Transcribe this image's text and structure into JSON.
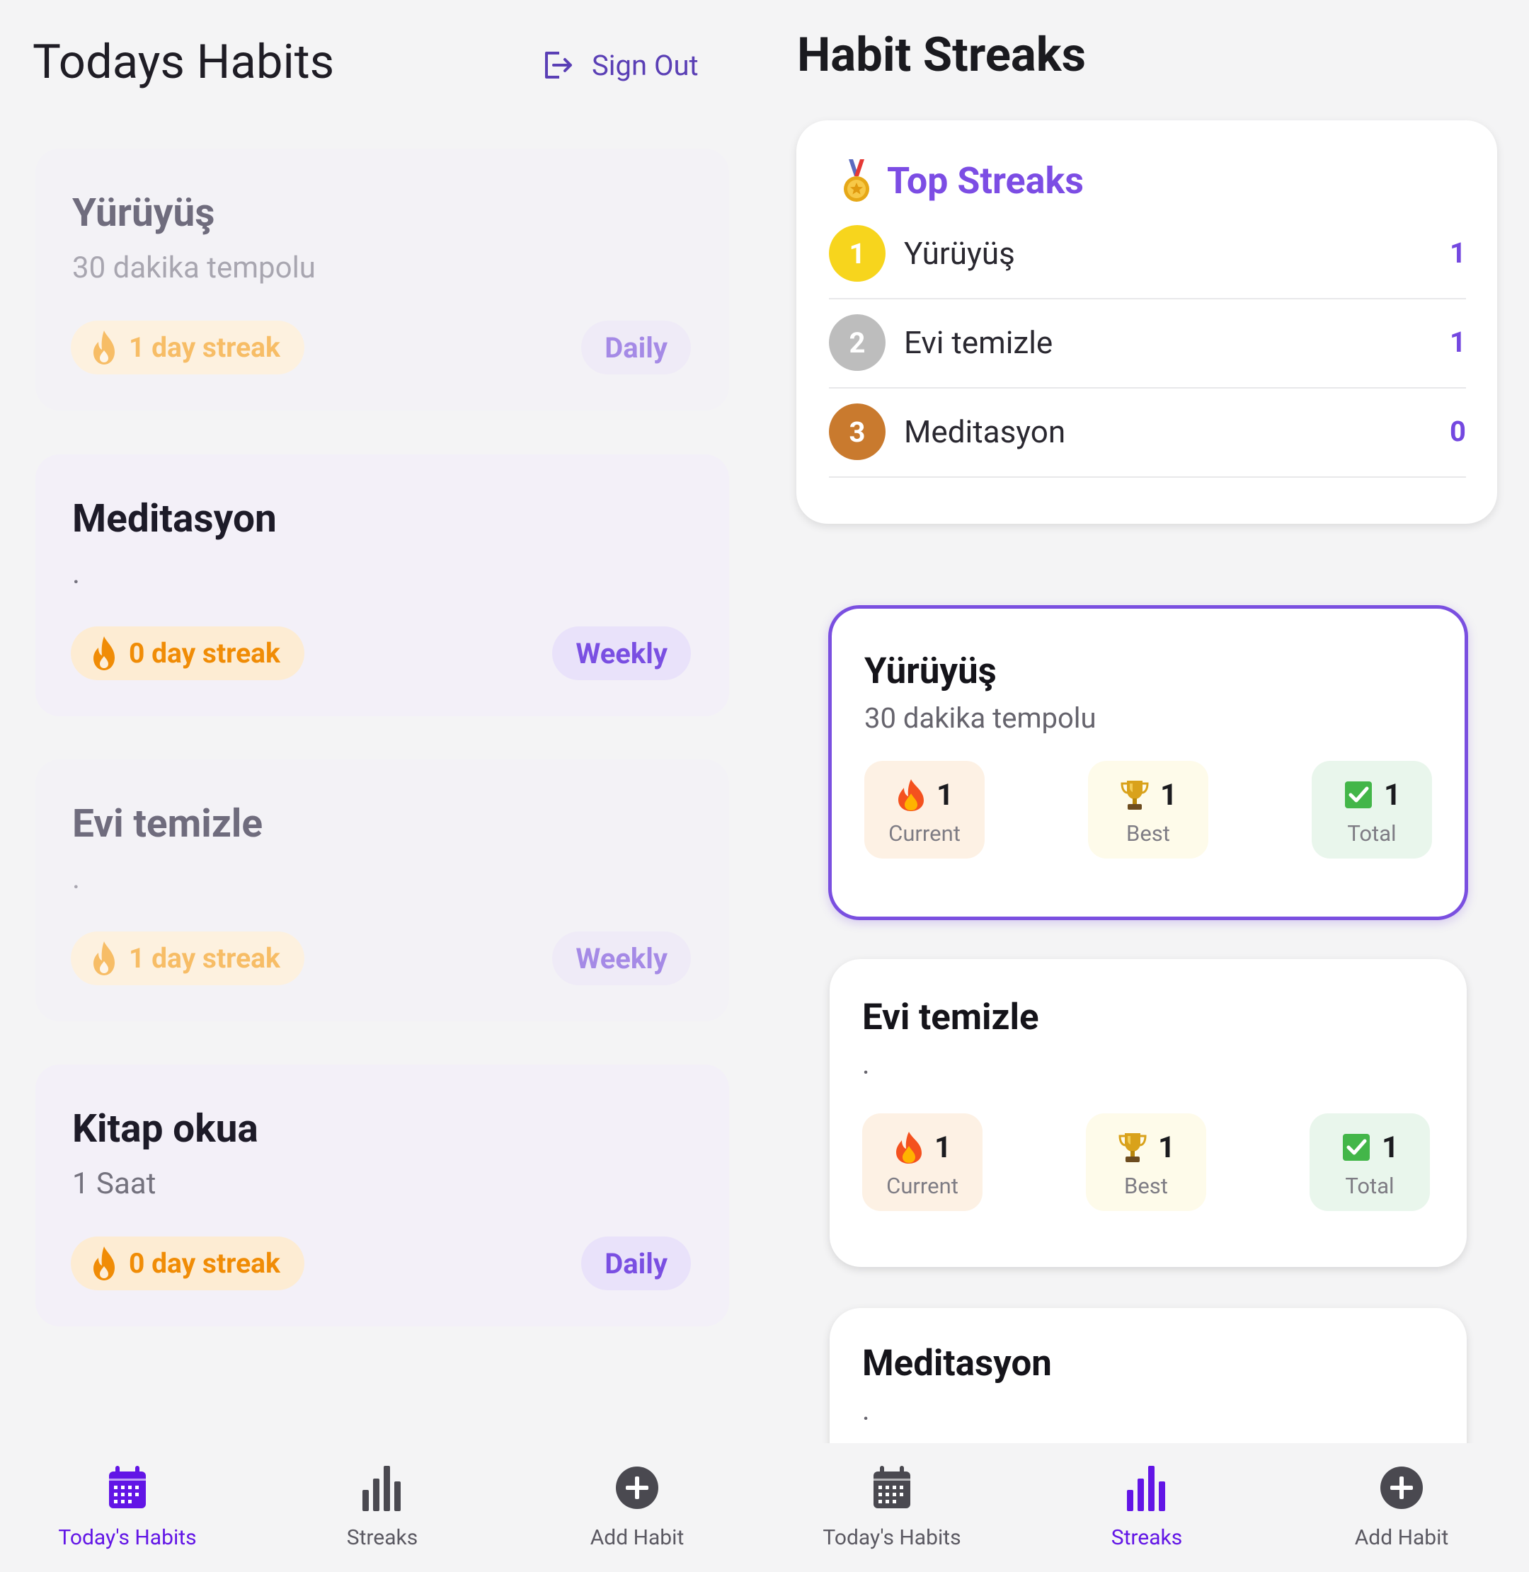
{
  "left": {
    "title": "Todays Habits",
    "sign_out": "Sign Out",
    "habits": [
      {
        "title": "Yürüyüş",
        "desc": "30 dakika tempolu",
        "streak": "1 day streak",
        "freq": "Daily"
      },
      {
        "title": "Meditasyon",
        "desc": ".",
        "streak": "0 day streak",
        "freq": "Weekly"
      },
      {
        "title": "Evi temizle",
        "desc": ".",
        "streak": "1 day streak",
        "freq": "Weekly"
      },
      {
        "title": "Kitap okua",
        "desc": "1 Saat",
        "streak": "0 day streak",
        "freq": "Daily"
      }
    ]
  },
  "right": {
    "title": "Habit Streaks",
    "top_streaks_title": "Top Streaks",
    "top_streaks": [
      {
        "rank": "1",
        "name": "Yürüyüş",
        "value": "1"
      },
      {
        "rank": "2",
        "name": "Evi temizle",
        "value": "1"
      },
      {
        "rank": "3",
        "name": "Meditasyon",
        "value": "0"
      }
    ],
    "cards": [
      {
        "title": "Yürüyüş",
        "desc": "30 dakika tempolu",
        "current": "1",
        "best": "1",
        "total": "1"
      },
      {
        "title": "Evi temizle",
        "desc": ".",
        "current": "1",
        "best": "1",
        "total": "1"
      },
      {
        "title": "Meditasyon",
        "desc": "."
      }
    ],
    "stat_labels": {
      "current": "Current",
      "best": "Best",
      "total": "Total"
    }
  },
  "nav": {
    "todays_habits": "Today's Habits",
    "streaks": "Streaks",
    "add_habit": "Add Habit"
  },
  "colors": {
    "accent": "#6215e6",
    "purple": "#7c4de4",
    "streak_orange": "#f08c06",
    "gold": "#f7d51d",
    "silver": "#bdbdbd",
    "bronze": "#c97a2e"
  }
}
